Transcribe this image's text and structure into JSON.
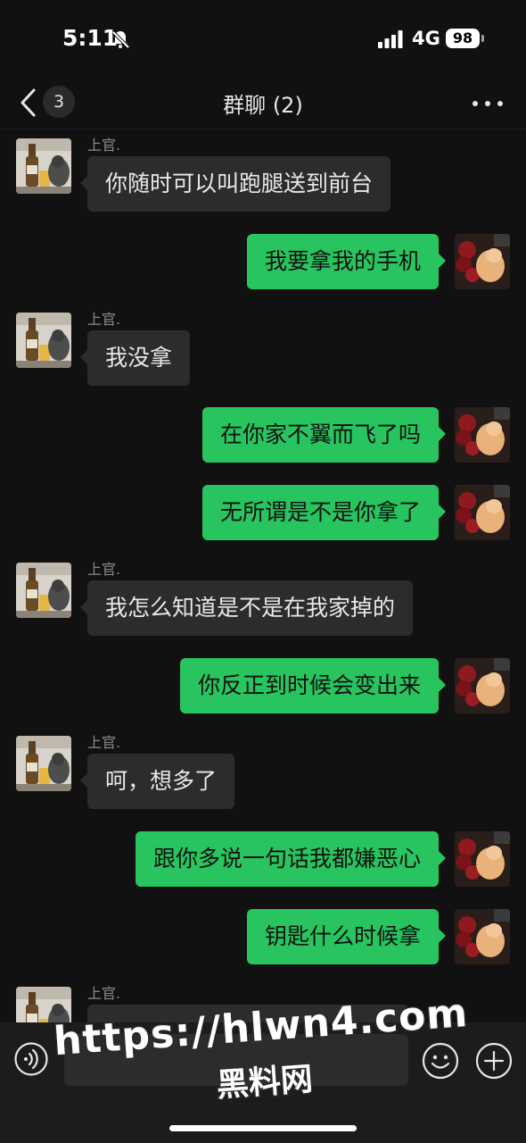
{
  "status_bar": {
    "time": "5:11",
    "network": "4G",
    "battery": "98",
    "icons": [
      "bell-off-icon",
      "signal-icon"
    ]
  },
  "nav": {
    "unread_count": "3",
    "title": "群聊 (2)",
    "icons": [
      "chevron-left-icon",
      "more-icon"
    ]
  },
  "messages": [
    {
      "side": "in",
      "sender": "上官.",
      "text": "你随时可以叫跑腿送到前台"
    },
    {
      "side": "out",
      "text": "我要拿我的手机"
    },
    {
      "side": "in",
      "sender": "上官.",
      "text": "我没拿"
    },
    {
      "side": "out",
      "text": "在你家不翼而飞了吗"
    },
    {
      "side": "out",
      "text": "无所谓是不是你拿了"
    },
    {
      "side": "in",
      "sender": "上官.",
      "text": "我怎么知道是不是在我家掉的"
    },
    {
      "side": "out",
      "text": "你反正到时候会变出来"
    },
    {
      "side": "in",
      "sender": "上官.",
      "text": "呵，想多了"
    },
    {
      "side": "out",
      "text": "跟你多说一句话我都嫌恶心"
    },
    {
      "side": "out",
      "text": "钥匙什么时候拿"
    },
    {
      "side": "in",
      "sender": "上官.",
      "text": ""
    }
  ],
  "input_bar": {
    "placeholder": "",
    "icons": [
      "voice-icon",
      "emoji-icon",
      "plus-icon"
    ]
  },
  "watermark": {
    "url": "https://hlwn4.com",
    "site": "黑料网"
  },
  "colors": {
    "background": "#111111",
    "incoming_bubble": "#2c2c2c",
    "outgoing_bubble": "#28c45f",
    "input_bar": "#1c1c1c"
  }
}
